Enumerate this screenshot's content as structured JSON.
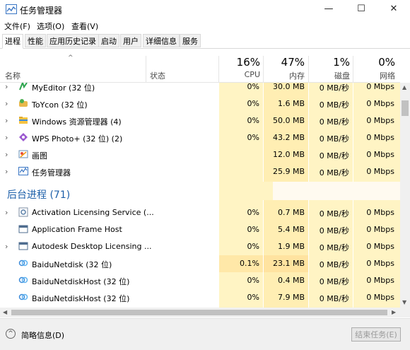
{
  "window": {
    "title": "任务管理器",
    "minimize": "—",
    "maximize": "☐",
    "close": "✕"
  },
  "menu": [
    "文件(F)",
    "选项(O)",
    "查看(V)"
  ],
  "tabs": [
    "进程",
    "性能",
    "应用历史记录",
    "启动",
    "用户",
    "详细信息",
    "服务"
  ],
  "active_tab": "进程",
  "columns": {
    "name": "名称",
    "status": "状态",
    "cpu": {
      "percent": "16%",
      "label": "CPU"
    },
    "memory": {
      "percent": "47%",
      "label": "内存"
    },
    "disk": {
      "percent": "1%",
      "label": "磁盘"
    },
    "network": {
      "percent": "0%",
      "label": "网络"
    }
  },
  "apps": [
    {
      "name": "MyEditor (32 位)",
      "cpu": "0%",
      "memory": "30.0 MB",
      "disk": "0 MB/秒",
      "network": "0 Mbps",
      "icon": "myeditor-icon"
    },
    {
      "name": "ToYcon (32 位)",
      "cpu": "0%",
      "memory": "1.6 MB",
      "disk": "0 MB/秒",
      "network": "0 Mbps",
      "icon": "toycon-icon"
    },
    {
      "name": "Windows 资源管理器 (4)",
      "cpu": "0%",
      "memory": "50.0 MB",
      "disk": "0 MB/秒",
      "network": "0 Mbps",
      "icon": "folder-icon"
    },
    {
      "name": "WPS Photo+ (32 位) (2)",
      "cpu": "0%",
      "memory": "43.2 MB",
      "disk": "0 MB/秒",
      "network": "0 Mbps",
      "icon": "wps-photo-icon"
    },
    {
      "name": "画图",
      "cpu": "",
      "memory": "12.0 MB",
      "disk": "0 MB/秒",
      "network": "0 Mbps",
      "icon": "paint-icon"
    },
    {
      "name": "任务管理器",
      "cpu": "",
      "memory": "25.9 MB",
      "disk": "0 MB/秒",
      "network": "0 Mbps",
      "icon": "task-manager-icon"
    }
  ],
  "background_section": {
    "title": "后台进程 (71)"
  },
  "background": [
    {
      "name": "Activation Licensing Service (...",
      "cpu": "0%",
      "memory": "0.7 MB",
      "disk": "0 MB/秒",
      "network": "0 Mbps",
      "icon": "service-icon",
      "expandable": true
    },
    {
      "name": "Application Frame Host",
      "cpu": "0%",
      "memory": "5.4 MB",
      "disk": "0 MB/秒",
      "network": "0 Mbps",
      "icon": "window-frame-icon",
      "expandable": false
    },
    {
      "name": "Autodesk Desktop Licensing ...",
      "cpu": "0%",
      "memory": "1.9 MB",
      "disk": "0 MB/秒",
      "network": "0 Mbps",
      "icon": "window-frame-icon",
      "expandable": true
    },
    {
      "name": "BaiduNetdisk (32 位)",
      "cpu": "0.1%",
      "memory": "23.1 MB",
      "disk": "0 MB/秒",
      "network": "0 Mbps",
      "icon": "baidu-netdisk-icon",
      "expandable": false
    },
    {
      "name": "BaiduNetdiskHost (32 位)",
      "cpu": "0%",
      "memory": "0.4 MB",
      "disk": "0 MB/秒",
      "network": "0 Mbps",
      "icon": "baidu-netdisk-icon",
      "expandable": false
    },
    {
      "name": "BaiduNetdiskHost (32 位)",
      "cpu": "0%",
      "memory": "7.9 MB",
      "disk": "0 MB/秒",
      "network": "0 Mbps",
      "icon": "baidu-netdisk-icon",
      "expandable": false
    }
  ],
  "footer": {
    "fewer_details": "简略信息(D)",
    "end_task": "结束任务(E)"
  },
  "colors": {
    "heat_light": "#fff4c4",
    "heat_mid": "#ffe8a8",
    "section_blue": "#1c5fa9"
  }
}
